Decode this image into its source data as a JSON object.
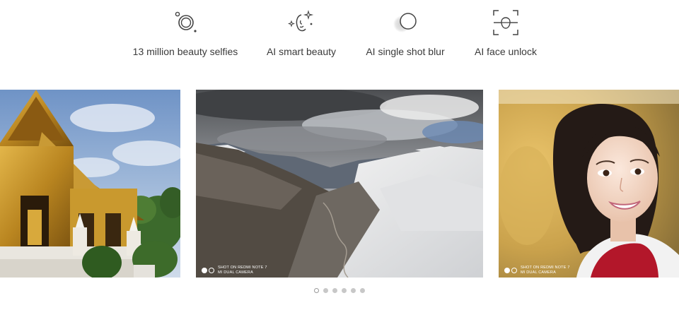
{
  "features": [
    {
      "label": "13 million beauty selfies",
      "icon": "selfie-camera-icon"
    },
    {
      "label": "AI smart beauty",
      "icon": "sparkle-face-icon"
    },
    {
      "label": "AI single shot blur",
      "icon": "blur-circle-icon"
    },
    {
      "label": "AI face unlock",
      "icon": "face-scan-icon"
    }
  ],
  "slides": [
    {
      "subject": "golden temple",
      "watermark": null
    },
    {
      "subject": "snowy mountain valley",
      "watermark": {
        "line1": "SHOT ON REDMI NOTE 7",
        "line2": "MI DUAL CAMERA"
      }
    },
    {
      "subject": "smiling woman portrait",
      "watermark": {
        "line1": "SHOT ON REDMI NOTE 7",
        "line2": "MI DUAL CAMERA"
      }
    }
  ],
  "pager": {
    "count": 6,
    "active_index": 0
  },
  "colors": {
    "text": "#3a3a3a",
    "icon": "#444444",
    "dot_inactive": "#c8c8c8"
  }
}
